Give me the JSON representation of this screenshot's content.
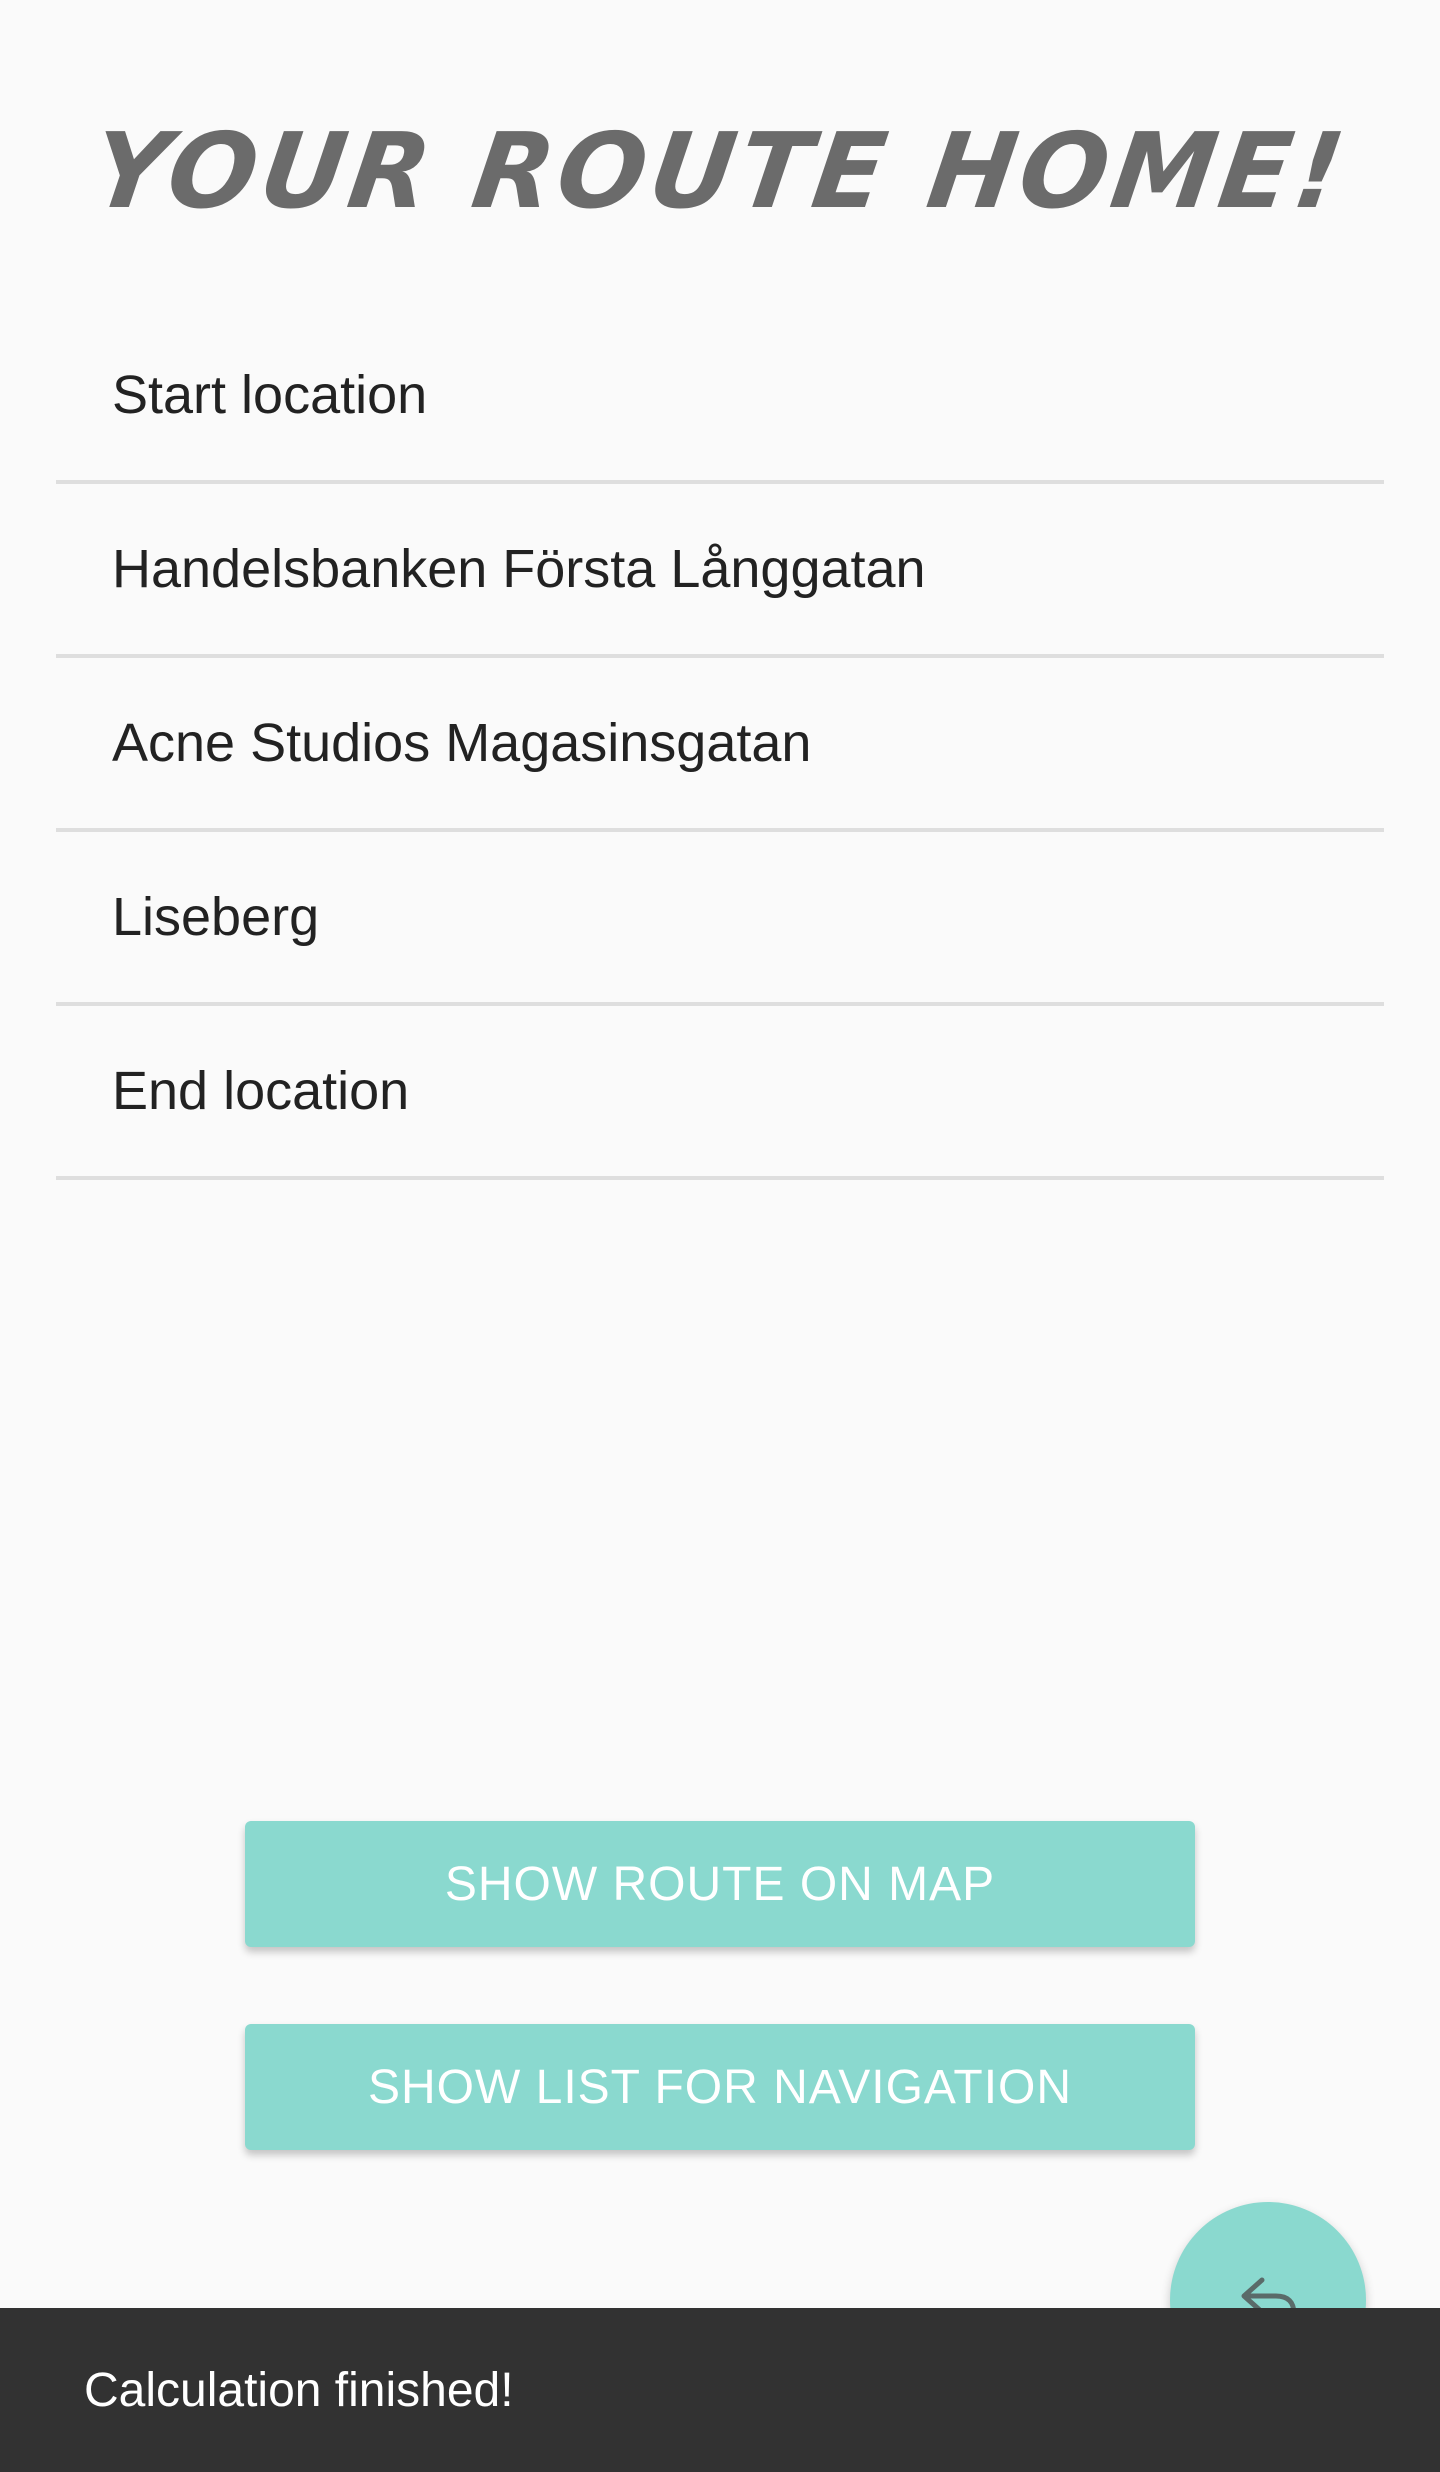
{
  "header": {
    "title": "YOUR ROUTE HOME!"
  },
  "route": {
    "stops": [
      {
        "label": "Start location"
      },
      {
        "label": "Handelsbanken Första Långgatan"
      },
      {
        "label": "Acne Studios Magasinsgatan"
      },
      {
        "label": "Liseberg"
      },
      {
        "label": "End location"
      }
    ]
  },
  "actions": {
    "show_map_label": "SHOW ROUTE ON MAP",
    "show_list_label": "SHOW LIST FOR NAVIGATION"
  },
  "fab": {
    "icon": "return-arrow-icon"
  },
  "snackbar": {
    "message": "Calculation finished!"
  },
  "colors": {
    "accent": "#8ad9cf",
    "title": "#6b6b6b",
    "snackbar_bg": "#323232",
    "background": "#fafafa"
  }
}
